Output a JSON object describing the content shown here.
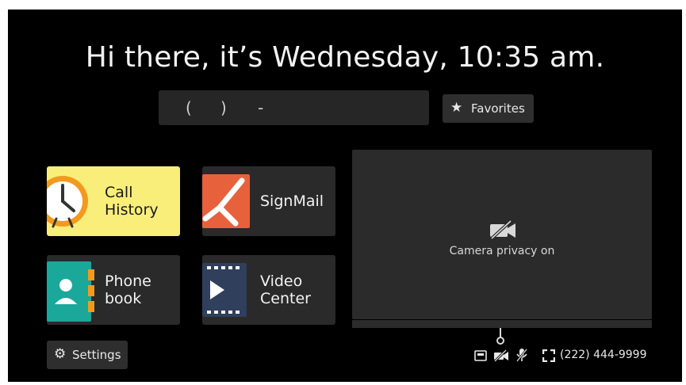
{
  "header": {
    "greeting": "Hi there, it’s Wednesday, 10:35 am."
  },
  "dialer": {
    "paren_open": "(",
    "paren_close": ")",
    "dash": "-"
  },
  "favorites_button": {
    "icon": "star-icon",
    "label": "Favorites"
  },
  "tiles": {
    "call_history": {
      "line1": "Call",
      "line2": "History",
      "icon": "clock-icon",
      "accent": "#f9ee7a"
    },
    "signmail": {
      "label": "SignMail",
      "icon": "signmail-icon",
      "accent": "#e8613d"
    },
    "phone_book": {
      "line1": "Phone",
      "line2": "book",
      "icon": "contact-book-icon",
      "accent": "#1aa89a"
    },
    "video_center": {
      "line1": "Video",
      "line2": "Center",
      "icon": "film-play-icon",
      "accent": "#2f3f5c"
    }
  },
  "camera_panel": {
    "status_text": "Camera privacy on",
    "icon": "camera-off-icon"
  },
  "settings_button": {
    "icon": "gear-icon",
    "label": "Settings"
  },
  "status_bar": {
    "icons": [
      "network-icon",
      "camera-off-icon",
      "mic-off-icon",
      "fullscreen-icon"
    ],
    "phone_number": "(222) 444-9999"
  }
}
